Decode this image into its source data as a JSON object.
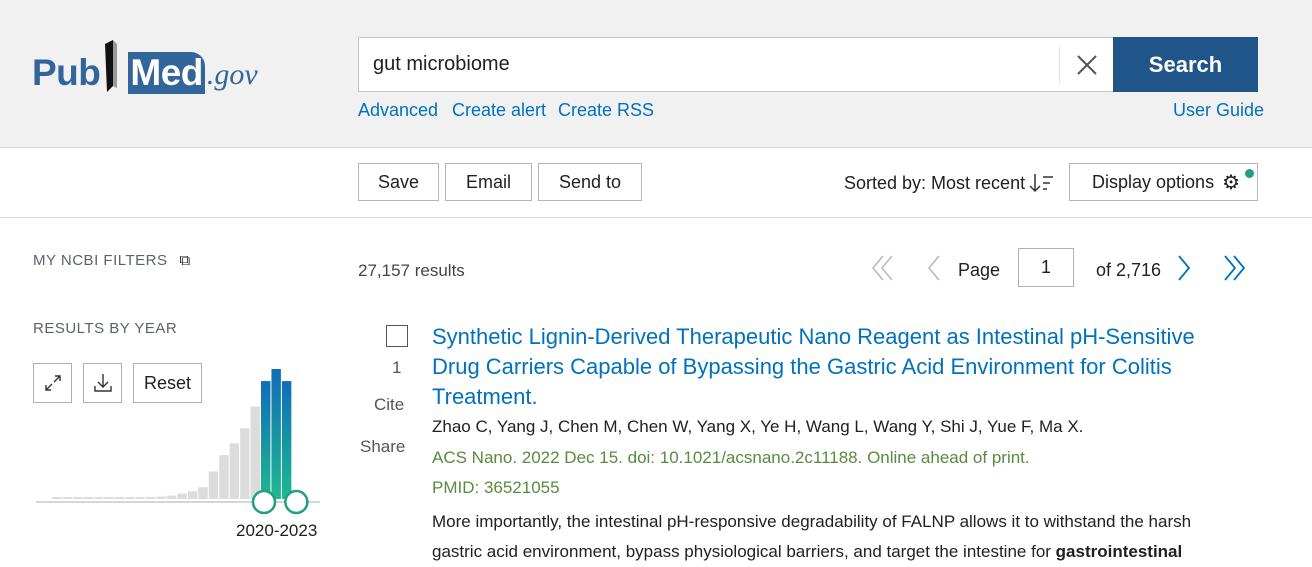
{
  "header": {
    "logo": {
      "pub": "Pub",
      "med": "Med",
      "gov": ".gov"
    },
    "search": {
      "value": "gut microbiome",
      "button": "Search"
    },
    "links": {
      "advanced": "Advanced",
      "create_alert": "Create alert",
      "create_rss": "Create RSS",
      "user_guide": "User Guide"
    }
  },
  "toolbar": {
    "save": "Save",
    "email": "Email",
    "send_to": "Send to",
    "sorted_by": "Sorted by: Most recent",
    "display_options": "Display options"
  },
  "sidebar": {
    "my_ncbi_filters": "MY NCBI FILTERS",
    "results_by_year": "RESULTS BY YEAR",
    "reset": "Reset",
    "range_label": "2020-2023",
    "chart_data": {
      "type": "bar",
      "bar_relative_counts": [
        6,
        6,
        6,
        6,
        6,
        6,
        6,
        6,
        6,
        6,
        7,
        10,
        16,
        23,
        35,
        82,
        131,
        166,
        211,
        276,
        352,
        388,
        352
      ],
      "selected_last": 3
    }
  },
  "results": {
    "count": "27,157 results",
    "page_label": "Page",
    "page": "1",
    "of_pages": "of 2,716",
    "items": [
      {
        "number": "1",
        "cite": "Cite",
        "share": "Share",
        "title": "Synthetic Lignin-Derived Therapeutic Nano Reagent as Intestinal pH-Sensitive Drug Carriers Capable of Bypassing the Gastric Acid Environment for Colitis Treatment.",
        "authors": "Zhao C, Yang J, Chen M, Chen W, Yang X, Ye H, Wang L, Wang Y, Shi J, Yue F, Ma X.",
        "citation": "ACS Nano. 2022 Dec 15. doi: 10.1021/acsnano.2c11188. Online ahead of print.",
        "pmid": "PMID: 36521055",
        "snippet": "More importantly, the intestinal pH-responsive degradability of FALNP allows it to withstand the harsh gastric acid environment, bypass physiological barriers, and target the intestine for ",
        "snippet_bold": "gastrointestinal"
      }
    ]
  },
  "colors": {
    "accent": "#20558a",
    "link": "#0071bc",
    "teal": "#20b08a",
    "dot": "#20a080"
  }
}
